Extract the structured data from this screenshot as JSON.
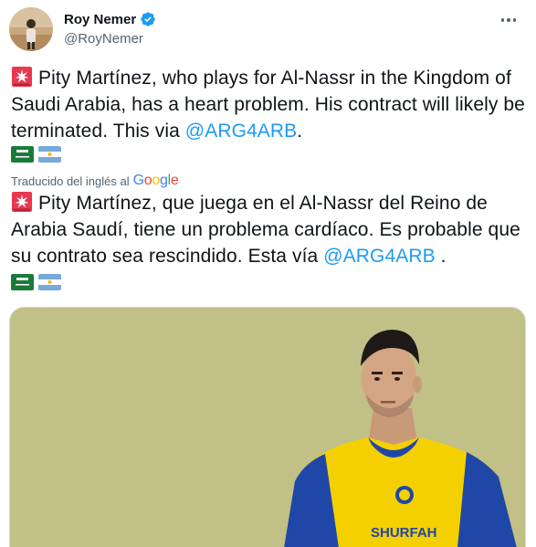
{
  "author": {
    "name": "Roy Nemer",
    "handle": "@RoyNemer",
    "avatar_icon": "user-avatar-photo",
    "verified_icon": "verified-badge-icon"
  },
  "tweet": {
    "original": {
      "text_before": "Pity Martínez, who plays for Al-Nassr in the Kingdom of Saudi Arabia, has a heart problem. His contract will likely be terminated. This via ",
      "mention": "@ARG4ARB",
      "text_after": "."
    },
    "translation_label": "Traducido del inglés al",
    "translation_brand": [
      "G",
      "o",
      "o",
      "g",
      "l",
      "e"
    ],
    "translated": {
      "text_before": "Pity Martínez, que juega en el Al-Nassr del Reino de Arabia Saudí, tiene un problema cardíaco. Es probable que su contrato sea rescindido. Esta vía ",
      "mention": "@ARG4ARB",
      "text_after": " ."
    },
    "emoji_icons": [
      "siren-icon",
      "saudi-arabia-flag-icon",
      "argentina-flag-icon"
    ],
    "media_icon": "player-photo",
    "jersey_sponsor": "SHURFAH"
  },
  "colors": {
    "link": "#1d9bf0",
    "secondary_text": "#536471",
    "photo_background": "#c3c48a",
    "jersey_yellow": "#f5d000",
    "jersey_blue": "#1f47a8"
  }
}
